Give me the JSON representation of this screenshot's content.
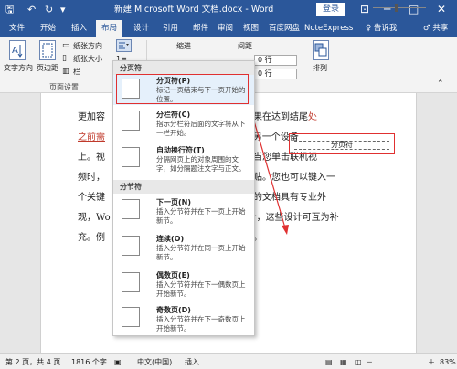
{
  "titlebar": {
    "save_icon": "save-icon",
    "undo_icon": "undo-icon",
    "redo_icon": "redo-icon",
    "title": "新建 Microsoft Word 文档.docx - Word",
    "login": "登录",
    "minimize": "─",
    "maximize": "□",
    "close": "✕",
    "ribbon_options": "⊡"
  },
  "tabs": [
    "文件",
    "开始",
    "插入",
    "布局",
    "设计",
    "引用",
    "邮件",
    "审阅",
    "视图",
    "百度网盘",
    "NoteExpress"
  ],
  "active_tab": "布局",
  "tell_me": "♀ 告诉我",
  "share": "♂ 共享",
  "ribbon": {
    "text_direction": "文字方向",
    "margins": "页边距",
    "orientation": "纸张方向",
    "size": "纸张大小",
    "columns": "栏",
    "breaks_icon": "breaks-icon",
    "indent": "缩进",
    "spacing": "间距",
    "spin_values": [
      "0 行",
      "0 行"
    ],
    "arrange": "排列",
    "page_setup_group": "页面设置"
  },
  "document": {
    "lines": [
      {
        "a": "更加容",
        "b": "需文本。如果在达到结尾",
        "red": "处",
        "c": ""
      },
      {
        "a": "",
        "red_start": "之前需",
        "b": "位置 - 即使在另一个设备",
        "c": ""
      },
      {
        "a": "上。视",
        "b": "您的观点，当您单击联机视",
        "c": ""
      },
      {
        "a": "频时，",
        "b": "进行粘贴。您也可以键入一",
        "c": ""
      },
      {
        "a": "个关键",
        "b": "为使您的文档具有专业外",
        "c": ""
      },
      {
        "a": "观，Wo",
        "b": "框设计，这些设计可互为补",
        "c": ""
      },
      {
        "a": "充。例",
        "b": "提要栏。",
        "c": ""
      }
    ],
    "page_break_label": "分页符"
  },
  "dropdown": {
    "section_page": "分页符",
    "section_section": "分节符",
    "items": [
      {
        "icon": "page-break-icon",
        "title": "分页符(P)",
        "desc": "标记一页结束与下一页开始的位置。"
      },
      {
        "icon": "column-break-icon",
        "title": "分栏符(C)",
        "desc": "指示分栏符后面的文字将从下一栏开始。"
      },
      {
        "icon": "text-wrapping-icon",
        "title": "自动换行符(T)",
        "desc": "分隔网页上的对象周围的文字，如分隔题注文字与正文。"
      },
      {
        "icon": "next-page-icon",
        "title": "下一页(N)",
        "desc": "插入分节符并在下一页上开始新节。"
      },
      {
        "icon": "continuous-icon",
        "title": "连续(O)",
        "desc": "插入分节符并在同一页上开始新节。"
      },
      {
        "icon": "even-page-icon",
        "title": "偶数页(E)",
        "desc": "插入分节符并在下一偶数页上开始新节。"
      },
      {
        "icon": "odd-page-icon",
        "title": "奇数页(D)",
        "desc": "插入分节符并在下一奇数页上开始新节。"
      }
    ]
  },
  "status": {
    "page": "第 2 页，共 4 页",
    "words": "1816 个字",
    "lang": "中文(中国)",
    "mode": "插入",
    "zoom": "83%",
    "zoom_minus": "－",
    "zoom_plus": "＋"
  },
  "colors": {
    "accent": "#2b579a",
    "highlight_box": "#e03030",
    "dropdown_highlight": "#e5f0fb"
  }
}
